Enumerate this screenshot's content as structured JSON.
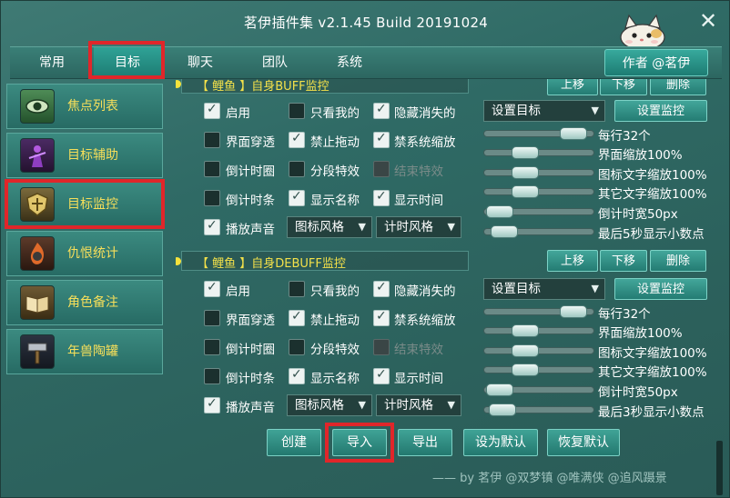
{
  "window": {
    "title": "茗伊插件集 v2.1.45 Build 20191024",
    "close_icon": "close-icon",
    "mascot_icon": "cat-mascot-icon"
  },
  "tabs": [
    {
      "label": "常用",
      "active": false
    },
    {
      "label": "目标",
      "active": true
    },
    {
      "label": "聊天",
      "active": false
    },
    {
      "label": "团队",
      "active": false
    },
    {
      "label": "系统",
      "active": false
    }
  ],
  "author_button": "作者 @茗伊",
  "sidebar": [
    {
      "label": "焦点列表",
      "icon": "eye-icon",
      "active": false
    },
    {
      "label": "目标辅助",
      "icon": "purple-figure-icon",
      "active": false
    },
    {
      "label": "目标监控",
      "icon": "golden-shield-icon",
      "active": true
    },
    {
      "label": "仇恨统计",
      "icon": "fire-mask-icon",
      "active": false
    },
    {
      "label": "角色备注",
      "icon": "open-book-icon",
      "active": false
    },
    {
      "label": "年兽陶罐",
      "icon": "hammer-icon",
      "active": false
    }
  ],
  "panels": [
    {
      "header": "【 鲤鱼 】自身BUFF监控",
      "buttons": {
        "up": "上移",
        "down": "下移",
        "delete": "删除"
      },
      "options": {
        "enable": {
          "label": "启用",
          "checked": true
        },
        "only_mine": {
          "label": "只看我的",
          "checked": false
        },
        "hide_vanish": {
          "label": "隐藏消失的",
          "checked": true
        },
        "ui_passthrough": {
          "label": "界面穿透",
          "checked": false
        },
        "no_drag": {
          "label": "禁止拖动",
          "checked": true
        },
        "no_sys_scale": {
          "label": "禁系统缩放",
          "checked": true
        },
        "countdown_circle": {
          "label": "倒计时圈",
          "checked": false
        },
        "segment_effect": {
          "label": "分段特效",
          "checked": false
        },
        "end_effect": {
          "label": "结束特效",
          "checked": false,
          "disabled": true
        },
        "countdown_bar": {
          "label": "倒计时条",
          "checked": false
        },
        "show_name": {
          "label": "显示名称",
          "checked": true
        },
        "show_time": {
          "label": "显示时间",
          "checked": true
        },
        "play_sound": {
          "label": "播放声音",
          "checked": true
        }
      },
      "icon_style": "图标风格",
      "timer_style": "计时风格",
      "target_select": "设置目标",
      "monitor_button": "设置监控",
      "sliders": [
        {
          "label": "每行32个",
          "level": 0.92
        },
        {
          "label": "界面缩放100%",
          "level": 0.33
        },
        {
          "label": "图标文字缩放100%",
          "level": 0.33
        },
        {
          "label": "其它文字缩放100%",
          "level": 0.33
        },
        {
          "label": "倒计时宽50px",
          "level": 0.02
        },
        {
          "label": "最后5秒显示小数点",
          "level": 0.08
        }
      ]
    },
    {
      "header": "【 鲤鱼 】自身DEBUFF监控",
      "buttons": {
        "up": "上移",
        "down": "下移",
        "delete": "删除"
      },
      "options": {
        "enable": {
          "label": "启用",
          "checked": true
        },
        "only_mine": {
          "label": "只看我的",
          "checked": false
        },
        "hide_vanish": {
          "label": "隐藏消失的",
          "checked": true
        },
        "ui_passthrough": {
          "label": "界面穿透",
          "checked": false
        },
        "no_drag": {
          "label": "禁止拖动",
          "checked": true
        },
        "no_sys_scale": {
          "label": "禁系统缩放",
          "checked": true
        },
        "countdown_circle": {
          "label": "倒计时圈",
          "checked": false
        },
        "segment_effect": {
          "label": "分段特效",
          "checked": false
        },
        "end_effect": {
          "label": "结束特效",
          "checked": false,
          "disabled": true
        },
        "countdown_bar": {
          "label": "倒计时条",
          "checked": false
        },
        "show_name": {
          "label": "显示名称",
          "checked": true
        },
        "show_time": {
          "label": "显示时间",
          "checked": true
        },
        "play_sound": {
          "label": "播放声音",
          "checked": true
        }
      },
      "icon_style": "图标风格",
      "timer_style": "计时风格",
      "target_select": "设置目标",
      "monitor_button": "设置监控",
      "sliders": [
        {
          "label": "每行32个",
          "level": 0.92
        },
        {
          "label": "界面缩放100%",
          "level": 0.33
        },
        {
          "label": "图标文字缩放100%",
          "level": 0.33
        },
        {
          "label": "其它文字缩放100%",
          "level": 0.33
        },
        {
          "label": "倒计时宽50px",
          "level": 0.02
        },
        {
          "label": "最后3秒显示小数点",
          "level": 0.06
        }
      ]
    }
  ],
  "bottom_buttons": {
    "create": "创建",
    "import": "导入",
    "export": "导出",
    "set_default": "设为默认",
    "restore_default": "恢复默认"
  },
  "credit": "—— by 茗伊 @双梦镇 @唯满侠 @追风蹑景",
  "colors": {
    "highlight_box": "#e0262a",
    "label_yellow": "#f7df5a",
    "panel_teal": "#2f6a65"
  }
}
